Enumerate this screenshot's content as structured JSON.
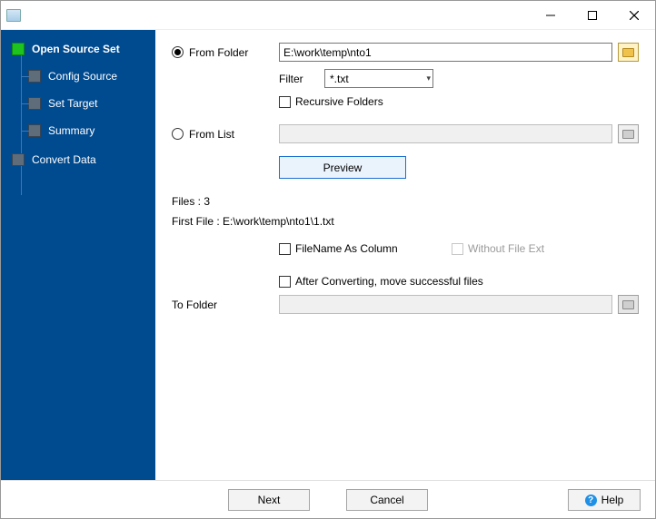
{
  "sidebar": {
    "items": [
      {
        "label": "Open Source Set",
        "active": true
      },
      {
        "label": "Config Source"
      },
      {
        "label": "Set Target"
      },
      {
        "label": "Summary"
      },
      {
        "label": "Convert Data"
      }
    ]
  },
  "main": {
    "from_folder_label": "From Folder",
    "from_folder_value": "E:\\work\\temp\\nto1",
    "filter_label": "Filter",
    "filter_value": "*.txt",
    "recursive_label": "Recursive Folders",
    "from_list_label": "From List",
    "from_list_value": "",
    "preview_label": "Preview",
    "files_count_label": "Files : 3",
    "first_file_label": "First File : E:\\work\\temp\\nto1\\1.txt",
    "filename_as_column_label": "FileName As Column",
    "without_ext_label": "Without File Ext",
    "after_convert_label": "After Converting, move successful files",
    "to_folder_label": "To Folder",
    "to_folder_value": ""
  },
  "footer": {
    "next": "Next",
    "cancel": "Cancel",
    "help": "Help"
  }
}
